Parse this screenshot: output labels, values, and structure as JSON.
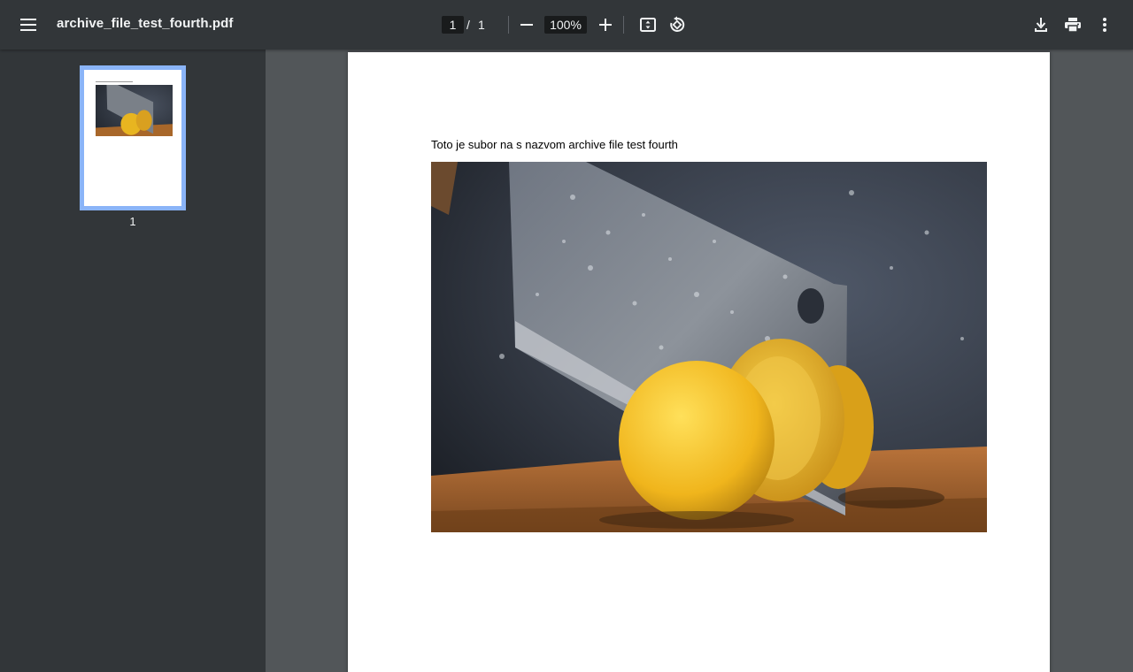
{
  "toolbar": {
    "title": "archive_file_test_fourth.pdf",
    "current_page": "1",
    "page_separator": "/",
    "total_pages": "1",
    "zoom": "100%"
  },
  "sidebar": {
    "thumbnails": [
      {
        "page_number": "1"
      }
    ]
  },
  "document": {
    "text": "Toto je subor na s nazvom archive file test fourth"
  },
  "colors": {
    "toolbar_bg": "#323639",
    "viewer_bg": "#525659",
    "thumbnail_border": "#8ab4f8"
  }
}
